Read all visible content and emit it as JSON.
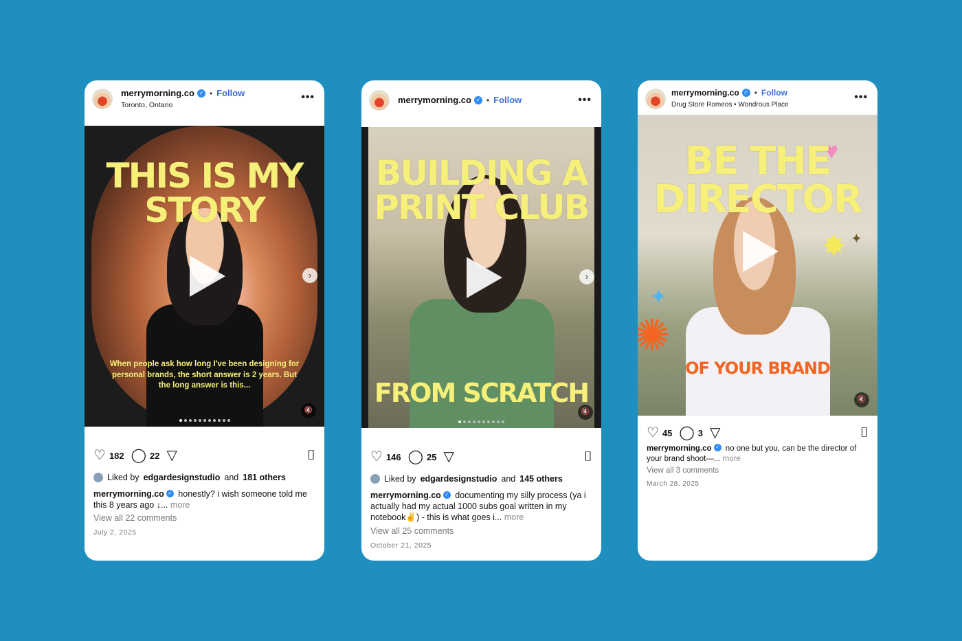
{
  "posts": [
    {
      "handle": "merrymorning.co",
      "follow": "Follow",
      "location": "Toronto, Ontario",
      "headline": "THIS IS MY STORY",
      "overlay": "When people ask how long I've been designing for personal brands, the short answer is 2 years. But the long answer is this...",
      "likes": "182",
      "comments_count": "22",
      "liked_by": "edgardesignstudio",
      "liked_others": "181 others",
      "caption": "honestly? i wish someone told me this 8 years ago ↓...",
      "more": "more",
      "view_comments": "View all 22 comments",
      "date": "July 2, 2025"
    },
    {
      "handle": "merrymorning.co",
      "follow": "Follow",
      "location": "",
      "headline": "BUILDING A PRINT CLUB",
      "overlay": "FROM SCRATCH",
      "likes": "146",
      "comments_count": "25",
      "liked_by": "edgardesignstudio",
      "liked_others": "145 others",
      "caption": "documenting my silly process (ya i actually had my actual 1000 subs goal written in my notebook✌️) - this is what goes i...",
      "more": "more",
      "view_comments": "View all 25 comments",
      "date": "October 21, 2025"
    },
    {
      "handle": "merrymorning.co",
      "follow": "Follow",
      "location": "Drug Store Romeos • Wondrous Place",
      "headline": "BE THE DIRECTOR",
      "overlay": "OF YOUR BRAND",
      "likes": "45",
      "comments_count": "3",
      "caption": "no one but you, can be the director of your brand shoot—...",
      "more": "more",
      "view_comments": "View all 3 comments",
      "date": "March 28, 2025"
    }
  ],
  "common": {
    "liked_prefix": "Liked by",
    "and": "and",
    "dot": "•",
    "more_icon": "•••",
    "heart_icon": "♡",
    "comment_icon": "◯",
    "share_icon": "▽",
    "save_icon": "⌷",
    "verified_icon": "✓",
    "next_icon": "›",
    "mute_icon": "🔇"
  }
}
